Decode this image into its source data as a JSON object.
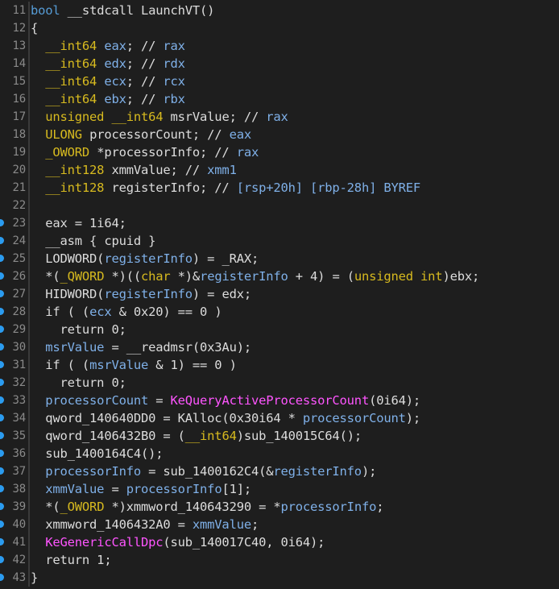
{
  "editor": {
    "lines": [
      {
        "num": "11",
        "bp": false,
        "tokens": [
          [
            "kw",
            "bool "
          ],
          [
            "pl",
            "__stdcall LaunchVT()"
          ]
        ]
      },
      {
        "num": "12",
        "bp": false,
        "tokens": [
          [
            "pl",
            "{"
          ]
        ]
      },
      {
        "num": "13",
        "bp": false,
        "tokens": [
          [
            "ty",
            "  __int64 "
          ],
          [
            "bl",
            "eax"
          ],
          [
            "pl",
            "; // "
          ],
          [
            "bl",
            "rax"
          ]
        ]
      },
      {
        "num": "14",
        "bp": false,
        "tokens": [
          [
            "ty",
            "  __int64 "
          ],
          [
            "bl",
            "edx"
          ],
          [
            "pl",
            "; // "
          ],
          [
            "bl",
            "rdx"
          ]
        ]
      },
      {
        "num": "15",
        "bp": false,
        "tokens": [
          [
            "ty",
            "  __int64 "
          ],
          [
            "bl",
            "ecx"
          ],
          [
            "pl",
            "; // "
          ],
          [
            "bl",
            "rcx"
          ]
        ]
      },
      {
        "num": "16",
        "bp": false,
        "tokens": [
          [
            "ty",
            "  __int64 "
          ],
          [
            "bl",
            "ebx"
          ],
          [
            "pl",
            "; // "
          ],
          [
            "bl",
            "rbx"
          ]
        ]
      },
      {
        "num": "17",
        "bp": false,
        "tokens": [
          [
            "ty",
            "  unsigned __int64 "
          ],
          [
            "pl",
            "msrValue; // "
          ],
          [
            "bl",
            "rax"
          ]
        ]
      },
      {
        "num": "18",
        "bp": false,
        "tokens": [
          [
            "ty",
            "  ULONG "
          ],
          [
            "pl",
            "processorCount; // "
          ],
          [
            "bl",
            "eax"
          ]
        ]
      },
      {
        "num": "19",
        "bp": false,
        "tokens": [
          [
            "ty",
            "  _OWORD "
          ],
          [
            "pl",
            "*processorInfo; // "
          ],
          [
            "bl",
            "rax"
          ]
        ]
      },
      {
        "num": "20",
        "bp": false,
        "tokens": [
          [
            "ty",
            "  __int128 "
          ],
          [
            "pl",
            "xmmValue; // "
          ],
          [
            "bl",
            "xmm1"
          ]
        ]
      },
      {
        "num": "21",
        "bp": false,
        "tokens": [
          [
            "ty",
            "  __int128 "
          ],
          [
            "pl",
            "registerInfo; // "
          ],
          [
            "bl",
            "[rsp+20h] [rbp-28h] BYREF"
          ]
        ]
      },
      {
        "num": "22",
        "bp": false,
        "tokens": [
          [
            "pl",
            ""
          ]
        ]
      },
      {
        "num": "23",
        "bp": true,
        "tokens": [
          [
            "pl",
            "  eax = 1i64;"
          ]
        ]
      },
      {
        "num": "24",
        "bp": true,
        "tokens": [
          [
            "pl",
            "  __asm { cpuid }"
          ]
        ]
      },
      {
        "num": "25",
        "bp": true,
        "tokens": [
          [
            "pl",
            "  LODWORD("
          ],
          [
            "bl",
            "registerInfo"
          ],
          [
            "pl",
            ") = _RAX;"
          ]
        ]
      },
      {
        "num": "26",
        "bp": true,
        "tokens": [
          [
            "pl",
            "  *("
          ],
          [
            "ty",
            "_QWORD"
          ],
          [
            "pl",
            " *)(("
          ],
          [
            "ty",
            "char"
          ],
          [
            "pl",
            " *)&"
          ],
          [
            "bl",
            "registerInfo"
          ],
          [
            "pl",
            " + 4) = ("
          ],
          [
            "ty",
            "unsigned int"
          ],
          [
            "pl",
            ")ebx;"
          ]
        ]
      },
      {
        "num": "27",
        "bp": true,
        "tokens": [
          [
            "pl",
            "  HIDWORD("
          ],
          [
            "bl",
            "registerInfo"
          ],
          [
            "pl",
            ") = edx;"
          ]
        ]
      },
      {
        "num": "28",
        "bp": true,
        "tokens": [
          [
            "pl",
            "  if ( ("
          ],
          [
            "bl",
            "ecx"
          ],
          [
            "pl",
            " & 0x20) == 0 )"
          ]
        ]
      },
      {
        "num": "29",
        "bp": true,
        "tokens": [
          [
            "pl",
            "    return 0;"
          ]
        ]
      },
      {
        "num": "30",
        "bp": true,
        "tokens": [
          [
            "bl",
            "  msrValue"
          ],
          [
            "pl",
            " = __readmsr(0x3Au);"
          ]
        ]
      },
      {
        "num": "31",
        "bp": true,
        "tokens": [
          [
            "pl",
            "  if ( ("
          ],
          [
            "bl",
            "msrValue"
          ],
          [
            "pl",
            " & 1) == 0 )"
          ]
        ]
      },
      {
        "num": "32",
        "bp": true,
        "tokens": [
          [
            "pl",
            "    return 0;"
          ]
        ]
      },
      {
        "num": "33",
        "bp": true,
        "tokens": [
          [
            "bl",
            "  processorCount"
          ],
          [
            "pl",
            " = "
          ],
          [
            "fn",
            "KeQueryActiveProcessorCount"
          ],
          [
            "pl",
            "(0i64);"
          ]
        ]
      },
      {
        "num": "34",
        "bp": true,
        "tokens": [
          [
            "pl",
            "  qword_140640DD0 = KAlloc(0x30i64 * "
          ],
          [
            "bl",
            "processorCount"
          ],
          [
            "pl",
            ");"
          ]
        ]
      },
      {
        "num": "35",
        "bp": true,
        "tokens": [
          [
            "pl",
            "  qword_1406432B0 = ("
          ],
          [
            "ty",
            "__int64"
          ],
          [
            "pl",
            ")sub_140015C64();"
          ]
        ]
      },
      {
        "num": "36",
        "bp": true,
        "tokens": [
          [
            "pl",
            "  sub_1400164C4();"
          ]
        ]
      },
      {
        "num": "37",
        "bp": true,
        "tokens": [
          [
            "bl",
            "  processorInfo"
          ],
          [
            "pl",
            " = sub_1400162C4(&"
          ],
          [
            "bl",
            "registerInfo"
          ],
          [
            "pl",
            ");"
          ]
        ]
      },
      {
        "num": "38",
        "bp": true,
        "tokens": [
          [
            "bl",
            "  xmmValue"
          ],
          [
            "pl",
            " = "
          ],
          [
            "bl",
            "processorInfo"
          ],
          [
            "pl",
            "[1];"
          ]
        ]
      },
      {
        "num": "39",
        "bp": true,
        "tokens": [
          [
            "pl",
            "  *("
          ],
          [
            "ty",
            "_OWORD"
          ],
          [
            "pl",
            " *)xmmword_140643290 = *"
          ],
          [
            "bl",
            "processorInfo"
          ],
          [
            "pl",
            ";"
          ]
        ]
      },
      {
        "num": "40",
        "bp": true,
        "tokens": [
          [
            "pl",
            "  xmmword_1406432A0 = "
          ],
          [
            "bl",
            "xmmValue"
          ],
          [
            "pl",
            ";"
          ]
        ]
      },
      {
        "num": "41",
        "bp": true,
        "tokens": [
          [
            "fn",
            "  KeGenericCallDpc"
          ],
          [
            "pl",
            "(sub_140017C40, 0i64);"
          ]
        ]
      },
      {
        "num": "42",
        "bp": true,
        "tokens": [
          [
            "pl",
            "  return 1;"
          ]
        ]
      },
      {
        "num": "43",
        "bp": true,
        "tokens": [
          [
            "pl",
            "}"
          ]
        ]
      }
    ]
  },
  "colors": {
    "background": "#1e1e1e",
    "keyword": "#569cd6",
    "type": "#d7ba1f",
    "function": "#ff55ff",
    "variable": "#7fb0e8",
    "breakpoint": "#2b9cf0"
  }
}
